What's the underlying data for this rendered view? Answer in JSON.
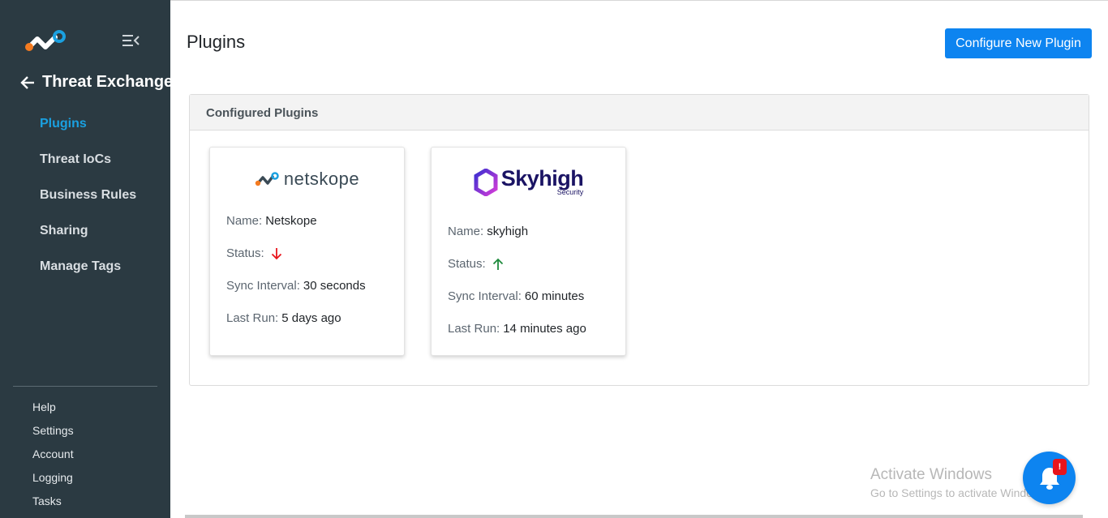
{
  "sidebar": {
    "logo_icon": "netskope-logo-icon",
    "collapse_icon": "collapse-menu-icon",
    "back_icon": "arrow-left-icon",
    "section_title": "Threat Exchange",
    "nav_items": [
      {
        "label": "Plugins",
        "active": true
      },
      {
        "label": "Threat IoCs",
        "active": false
      },
      {
        "label": "Business Rules",
        "active": false
      },
      {
        "label": "Sharing",
        "active": false
      },
      {
        "label": "Manage Tags",
        "active": false
      }
    ],
    "bottom_items": [
      "Help",
      "Settings",
      "Account",
      "Logging",
      "Tasks"
    ]
  },
  "main": {
    "title": "Plugins",
    "configure_button": "Configure New Plugin",
    "panel_title": "Configured Plugins",
    "plugins": [
      {
        "logo_text": "netskope",
        "name_label": "Name:",
        "name": "Netskope",
        "status_label": "Status:",
        "status": "down",
        "status_icon": "arrow-down-icon",
        "sync_label": "Sync Interval:",
        "sync_interval": "30 seconds",
        "last_run_label": "Last Run:",
        "last_run": "5 days ago"
      },
      {
        "logo_text": "Skyhigh",
        "logo_subtext": "Security",
        "name_label": "Name:",
        "name": "skyhigh",
        "status_label": "Status:",
        "status": "up",
        "status_icon": "arrow-up-icon",
        "sync_label": "Sync Interval:",
        "sync_interval": "60 minutes",
        "last_run_label": "Last Run:",
        "last_run": "14 minutes ago"
      }
    ]
  },
  "watermark": {
    "line1": "Activate Windows",
    "line2": "Go to Settings to activate Windows."
  },
  "notification": {
    "icon": "bell-icon",
    "badge": "!"
  },
  "colors": {
    "sidebar_bg": "#2b3a42",
    "active_nav": "#1aa0e0",
    "primary": "#0d84f0",
    "status_down": "#e8141b",
    "status_up": "#1e8a3c"
  }
}
